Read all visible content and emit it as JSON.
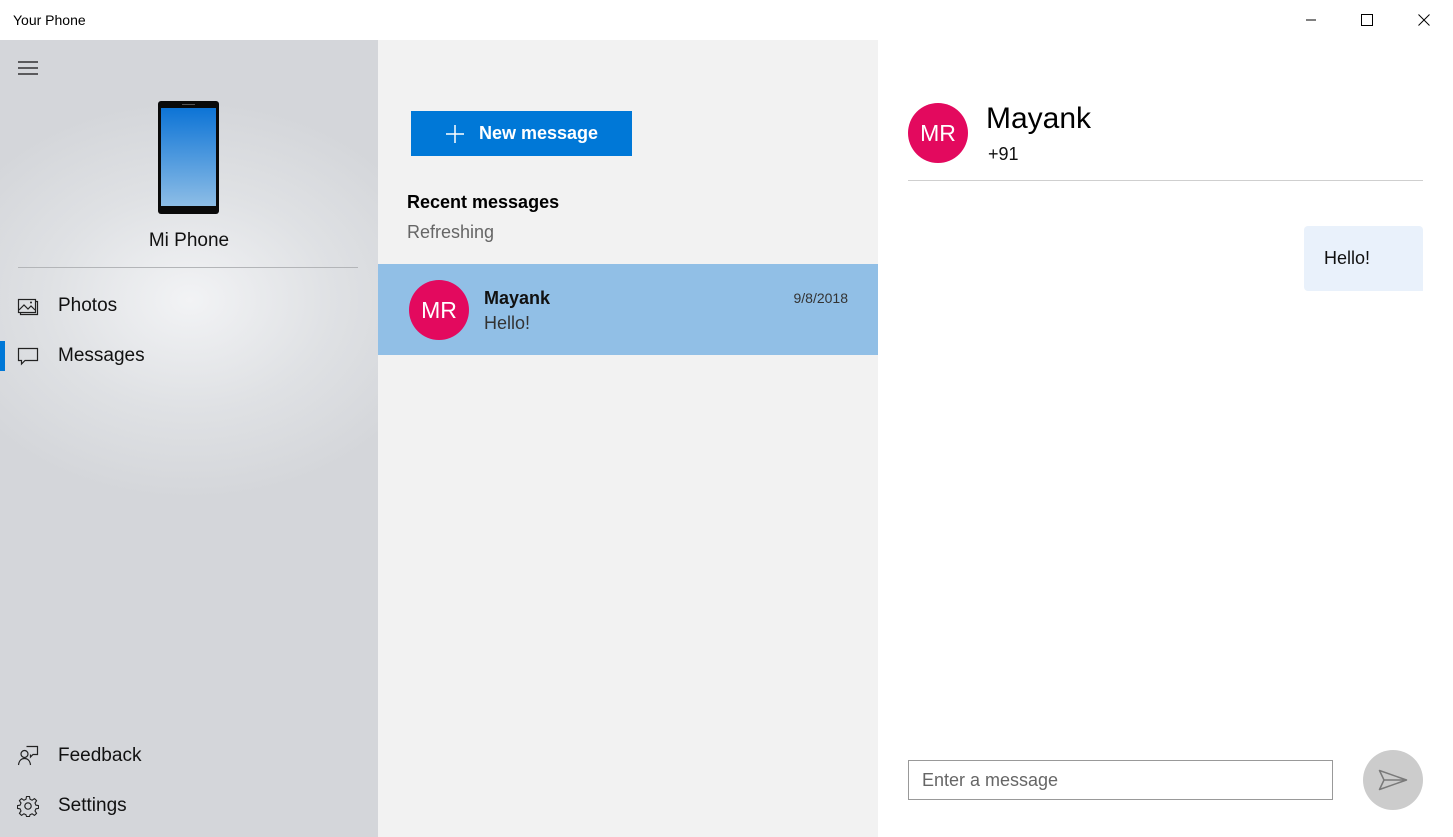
{
  "window": {
    "title": "Your Phone",
    "controls": {
      "minimize": "minimize-icon",
      "maximize": "maximize-icon",
      "close": "close-icon"
    }
  },
  "sidebar": {
    "menu_icon": "hamburger-icon",
    "device_icon": "phone-icon",
    "device_name": "Mi Phone",
    "items": [
      {
        "label": "Photos",
        "icon": "photos-icon",
        "active": false
      },
      {
        "label": "Messages",
        "icon": "message-icon",
        "active": true
      }
    ],
    "footer_items": [
      {
        "label": "Feedback",
        "icon": "feedback-icon"
      },
      {
        "label": "Settings",
        "icon": "gear-icon"
      }
    ]
  },
  "message_list": {
    "new_message_label": "New message",
    "new_message_icon": "plus-icon",
    "section_title": "Recent messages",
    "status": "Refreshing",
    "conversations": [
      {
        "initials": "MR",
        "name": "Mayank",
        "preview": "Hello!",
        "date": "9/8/2018",
        "selected": true
      }
    ]
  },
  "conversation": {
    "contact": {
      "initials": "MR",
      "name": "Mayank",
      "number": "+91"
    },
    "messages": [
      {
        "text": "Hello!",
        "direction": "outgoing"
      }
    ],
    "compose": {
      "placeholder": "Enter a message",
      "value": ""
    },
    "send_icon": "send-icon"
  },
  "colors": {
    "accent": "#0078d7",
    "avatar": "#e3095e",
    "selected_item": "#91bfe6",
    "outgoing_bubble": "#e9f1fb",
    "send_button": "#cccccc"
  }
}
